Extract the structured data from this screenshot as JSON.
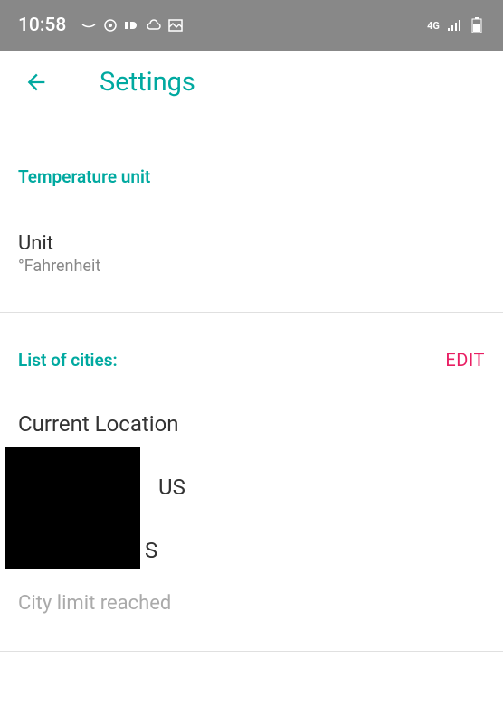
{
  "status_bar": {
    "time": "10:58",
    "network_indicator": "4G",
    "signal": "signal",
    "battery": "battery"
  },
  "app_bar": {
    "title": "Settings"
  },
  "temperature_section": {
    "header": "Temperature unit",
    "item_label": "Unit",
    "item_value": "°Fahrenheit"
  },
  "cities_section": {
    "header": "List of cities:",
    "edit_label": "EDIT",
    "current_location_label": "Current Location",
    "cities": [
      {
        "suffix": "US"
      },
      {
        "suffix": "S"
      }
    ],
    "limit_message": "City limit reached"
  }
}
